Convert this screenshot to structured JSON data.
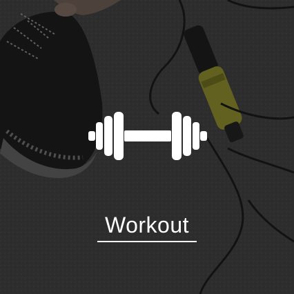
{
  "tile": {
    "label": "Workout",
    "icon": "dumbbell-icon",
    "background_image": "sneaker-and-jump-rope-photo",
    "text_color": "#ffffff",
    "overlay_color": "#141414"
  }
}
